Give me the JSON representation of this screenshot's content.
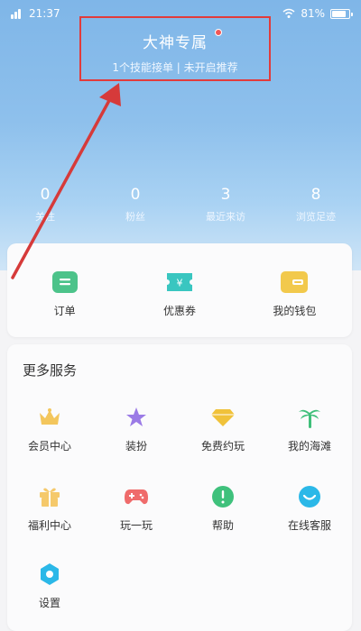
{
  "status_bar": {
    "time": "21:37",
    "battery": "81%"
  },
  "vip": {
    "title": "大神专属",
    "subtitle": "1个技能接单 | 未开启推荐"
  },
  "stats": [
    {
      "value": "0",
      "label": "关注"
    },
    {
      "value": "0",
      "label": "粉丝"
    },
    {
      "value": "3",
      "label": "最近来访"
    },
    {
      "value": "8",
      "label": "浏览足迹"
    }
  ],
  "quick_actions": [
    {
      "label": "订单",
      "icon": "order-icon"
    },
    {
      "label": "优惠券",
      "icon": "coupon-icon"
    },
    {
      "label": "我的钱包",
      "icon": "wallet-icon"
    }
  ],
  "more_services": {
    "title": "更多服务",
    "items": [
      {
        "label": "会员中心",
        "icon": "crown-icon"
      },
      {
        "label": "装扮",
        "icon": "star-icon"
      },
      {
        "label": "免费约玩",
        "icon": "diamond-icon"
      },
      {
        "label": "我的海滩",
        "icon": "palm-tree-icon"
      },
      {
        "label": "福利中心",
        "icon": "gift-icon"
      },
      {
        "label": "玩一玩",
        "icon": "gamepad-icon"
      },
      {
        "label": "帮助",
        "icon": "help-icon"
      },
      {
        "label": "在线客服",
        "icon": "customer-service-icon"
      },
      {
        "label": "设置",
        "icon": "settings-icon"
      }
    ]
  },
  "colors": {
    "header_blue": "#7fb6e8",
    "highlight_red": "#e23b3b",
    "arrow_red": "#d63a3a"
  }
}
